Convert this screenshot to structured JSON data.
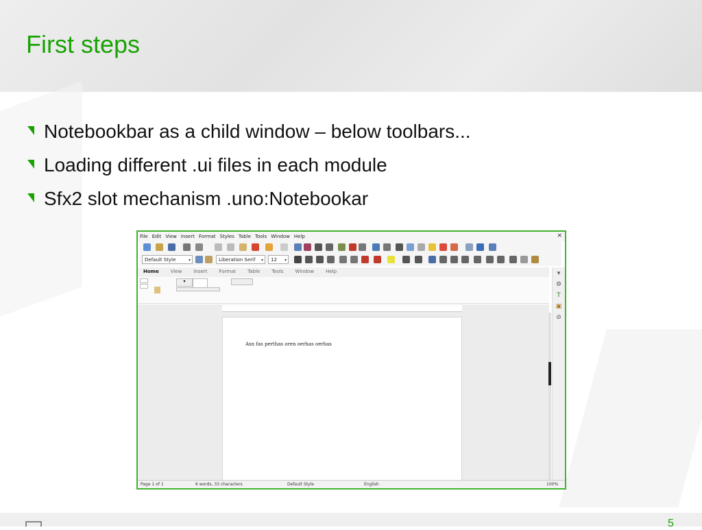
{
  "slide": {
    "title": "First steps",
    "bullets": [
      "Notebookbar as a child window – below toolbars...",
      "Loading different .ui files in each module",
      "Sfx2 slot mechanism .uno:Notebookar"
    ],
    "page_number": "5",
    "accent_color": "#18a303"
  },
  "screenshot": {
    "menu": [
      "File",
      "Edit",
      "View",
      "Insert",
      "Format",
      "Styles",
      "Table",
      "Tools",
      "Window",
      "Help"
    ],
    "close_glyph": "×",
    "paragraph_style": "Default Style",
    "font_name": "Liberation Serif",
    "font_size": "12",
    "notebookbar_tabs": [
      "Home",
      "View",
      "Insert",
      "Format",
      "Table",
      "Tools",
      "Window",
      "Help"
    ],
    "active_tab": "Home",
    "document_text": "Asn fas perthas oren oerhas oerhas",
    "status": {
      "page": "Page 1 of 1",
      "words": "6 words, 33 characters",
      "style": "Default Style",
      "language": "English",
      "zoom": "100%"
    },
    "icons": [
      "new-document-icon",
      "open-icon",
      "save-icon",
      "print-icon",
      "cut-icon",
      "copy-icon",
      "paste-icon",
      "undo-icon",
      "redo-icon",
      "find-icon",
      "spellcheck-icon",
      "formatting-marks-icon",
      "table-icon",
      "image-icon",
      "chart-icon",
      "textbox-icon",
      "special-character-icon",
      "hyperlink-icon",
      "footnote-icon",
      "comment-icon",
      "line-icon",
      "shapes-icon"
    ]
  }
}
